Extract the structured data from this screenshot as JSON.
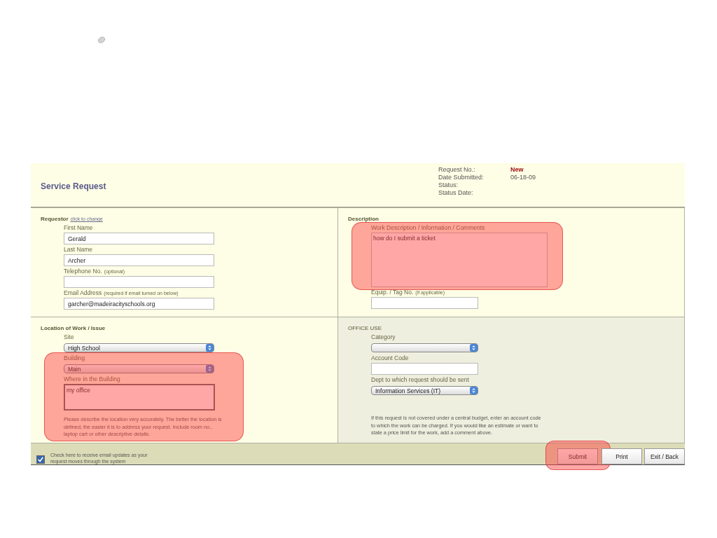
{
  "header": {
    "title": "Service Request",
    "meta": [
      {
        "label": "Request No.:",
        "value": "New",
        "kind": "status"
      },
      {
        "label": "Date Submitted:",
        "value": "06-18-09",
        "kind": "plain"
      },
      {
        "label": "Status:",
        "kind": "plain"
      },
      {
        "label": "Status Date:",
        "kind": "plain"
      }
    ]
  },
  "sections": [
    {
      "title": "Requestor",
      "link": "click to change",
      "kind": "form",
      "items": [
        {
          "kind": "text",
          "label": "First Name",
          "value": "Gerald",
          "highlighted": false
        },
        {
          "kind": "text",
          "label": "Last Name",
          "value": "Archer",
          "highlighted": false
        },
        {
          "kind": "text",
          "label": "Telephone No.",
          "note": "(optional)",
          "highlighted": false
        },
        {
          "kind": "text",
          "label": "Email Address",
          "note": "(required if email turned on below)",
          "value": "garcher@madeiracityschools.org",
          "highlighted": false
        }
      ]
    },
    {
      "title": "Description",
      "kind": "form",
      "items": [
        {
          "kind": "textarea",
          "label": "Work Description / Information / Comments",
          "value": "how do I submit a ticket",
          "highlighted": true
        },
        {
          "kind": "short",
          "label": "Equip. / Tag No.",
          "note": "(if applicable)",
          "highlighted": false
        }
      ]
    },
    {
      "title": "Location of Work / Issue",
      "kind": "form",
      "items": [
        {
          "kind": "select",
          "label": "Site",
          "value": "High School",
          "highlighted": false
        },
        {
          "kind": "select",
          "label": "Building",
          "value": "Main",
          "highlighted": true
        },
        {
          "kind": "smallarea",
          "label": "Where in the Building",
          "value": "my office",
          "highlighted": true
        },
        {
          "kind": "note",
          "text": "Please describe the location very accurately. The better the location is defined, the easier it is to address your request. Include room no., laptop cart or other descriptive details.",
          "highlighted": true
        }
      ]
    },
    {
      "title": "OFFICE USE",
      "kind": "office",
      "items": [
        {
          "kind": "shortselect",
          "label": "Category",
          "highlighted": false
        },
        {
          "kind": "short",
          "label": "Account Code",
          "highlighted": false
        },
        {
          "kind": "shortselect",
          "label": "Dept to which request should be sent",
          "value": "Information Services (IT)",
          "highlighted": false
        },
        {
          "kind": "note",
          "text": "If this request is not covered under a central budget, enter an account code to which the work can be charged. If you would like an estimate or want to state a price limit for the work, add a comment above.",
          "highlighted": false
        }
      ]
    }
  ],
  "footer": {
    "email_updates": {
      "label": "Check here to receive email updates as your request moves through the system",
      "checked": true
    },
    "buttons": [
      {
        "label": "Submit",
        "highlighted": true
      },
      {
        "label": "Print",
        "highlighted": false
      },
      {
        "label": "Exit / Back",
        "highlighted": false
      }
    ]
  }
}
